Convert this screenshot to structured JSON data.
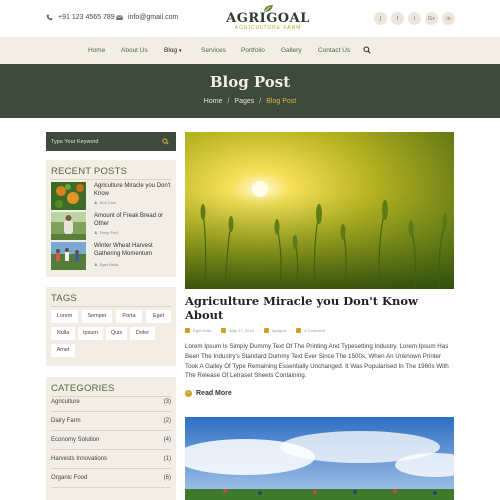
{
  "topbar": {
    "phone": "+91 123 4565 789",
    "email": "info@gmail.com",
    "phone_icon": "phone-icon",
    "email_icon": "envelope-icon",
    "logo_title": "AGRIGOAL",
    "logo_subtitle": "AGRICULTURE FARM",
    "socials": [
      {
        "icon": "rss-icon",
        "glyph": "ʃ"
      },
      {
        "icon": "facebook-icon",
        "glyph": "f"
      },
      {
        "icon": "twitter-icon",
        "glyph": "t"
      },
      {
        "icon": "google-plus-icon",
        "glyph": "G+"
      },
      {
        "icon": "linkedin-icon",
        "glyph": "in"
      }
    ]
  },
  "nav": {
    "items": [
      {
        "label": "Home"
      },
      {
        "label": "About Us"
      },
      {
        "label": "Blog",
        "caret": "▾"
      },
      {
        "label": "Services"
      },
      {
        "label": "Portfolio"
      },
      {
        "label": "Gallery"
      },
      {
        "label": "Contact Us"
      }
    ],
    "active_index": 2,
    "search_icon": "search-icon"
  },
  "banner": {
    "title": "Blog Post",
    "breadcrumbs": [
      "Home",
      "Pages",
      "Blog Post"
    ],
    "separator": "/"
  },
  "sidebar": {
    "search": {
      "placeholder": "Type Your Keyword",
      "icon": "search-icon"
    },
    "recent": {
      "title": "RECENT POSTS",
      "posts": [
        {
          "title": "Agriculture Miracle you Don't Know",
          "author": "Null Gum"
        },
        {
          "title": "Amount of Freak Bread or Other",
          "author": "Temp Port"
        },
        {
          "title": "Winter Wheat Harvest Gathering Momentum",
          "author": "Eget Nulla"
        }
      ]
    },
    "tags": {
      "title": "TAGS",
      "items": [
        "Lorem",
        "Semper",
        "Porta",
        "Eget",
        "Nulla",
        "Ipsum",
        "Quis",
        "Dolor",
        "Amet"
      ]
    },
    "categories": {
      "title": "CATEGORIES",
      "items": [
        {
          "name": "Agriculture",
          "count": "(3)"
        },
        {
          "name": "Dairy Farm",
          "count": "(2)"
        },
        {
          "name": "Economy Solution",
          "count": "(4)"
        },
        {
          "name": "Harvests Innovations",
          "count": "(1)"
        },
        {
          "name": "Organic Food",
          "count": "(6)"
        }
      ]
    }
  },
  "post": {
    "title": "Agriculture Miracle you Don't Know About",
    "meta": {
      "author": "Eget Nulla",
      "date": "May 27, 2018",
      "category": "Agrigoal",
      "comments": "6 Comment"
    },
    "excerpt": "Lorem Ipsum Is Simply Dummy Text Of The Printing And Typesetting Industry. Lorem Ipsum Has Been The Industry's Standard Dummy Text Ever Since The 1500s, When An Unknown Printer Took A Galley Of Type Remaining Essentially Unchanged. It Was Popularised In The 1960s With The Release Of Letraset Sheets Containing.",
    "read_more": "Read More"
  },
  "colors": {
    "dark_green": "#3e4a3c",
    "cream": "#f2eee6",
    "gold": "#c9a227",
    "link_green": "#4c6a3c"
  }
}
